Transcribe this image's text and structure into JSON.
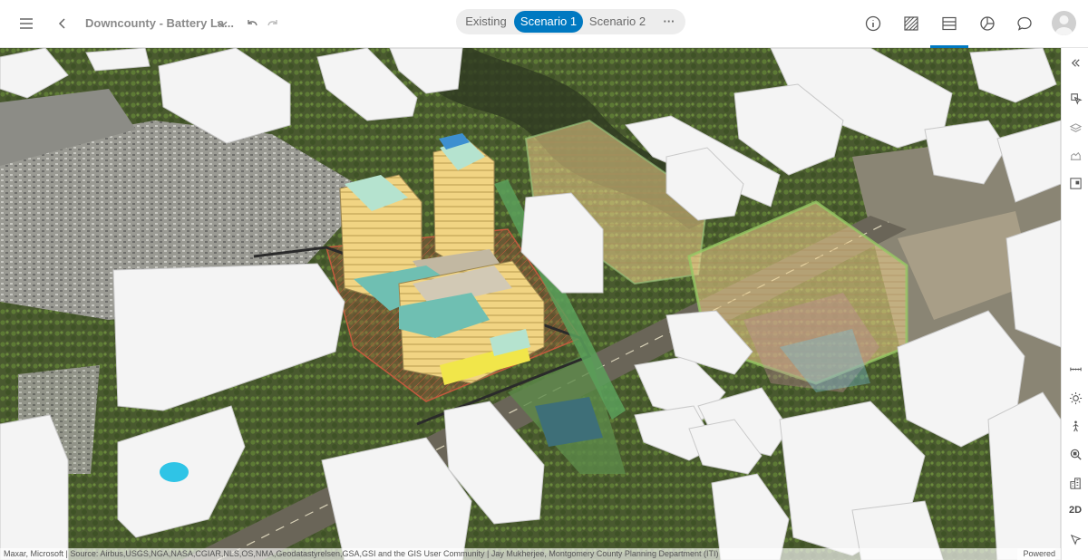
{
  "header": {
    "title": "Downcounty - Battery La...",
    "scenarios": [
      {
        "label": "Existing",
        "active": false
      },
      {
        "label": "Scenario 1",
        "active": true
      },
      {
        "label": "Scenario 2",
        "active": false
      }
    ],
    "more_label": "···",
    "tools": [
      "info-icon",
      "hatch-pattern-icon",
      "table-icon",
      "pie-chart-icon",
      "chat-icon"
    ],
    "accent_color": "#0079c1"
  },
  "map": {
    "attribution": "Maxar, Microsoft | Source: Airbus,USGS,NGA,NASA,CGIAR,NLS,OS,NMA,Geodatastyrelsen,GSA,GSI and the GIS User Community | Jay Mukherjee, Montgomery County Planning Department (ITI)",
    "powered": "Powered"
  },
  "rail": {
    "collapse": "collapse-panel-icon",
    "top_tools": [
      "navigate-icon",
      "layers-icon",
      "elevation-icon",
      "selection-icon"
    ],
    "bottom_tools": [
      "measure-icon",
      "daylight-icon",
      "walk-icon",
      "search-map-icon",
      "buildings-icon"
    ],
    "toggle_2d": "2D",
    "bottom_last": "cursor-icon"
  }
}
